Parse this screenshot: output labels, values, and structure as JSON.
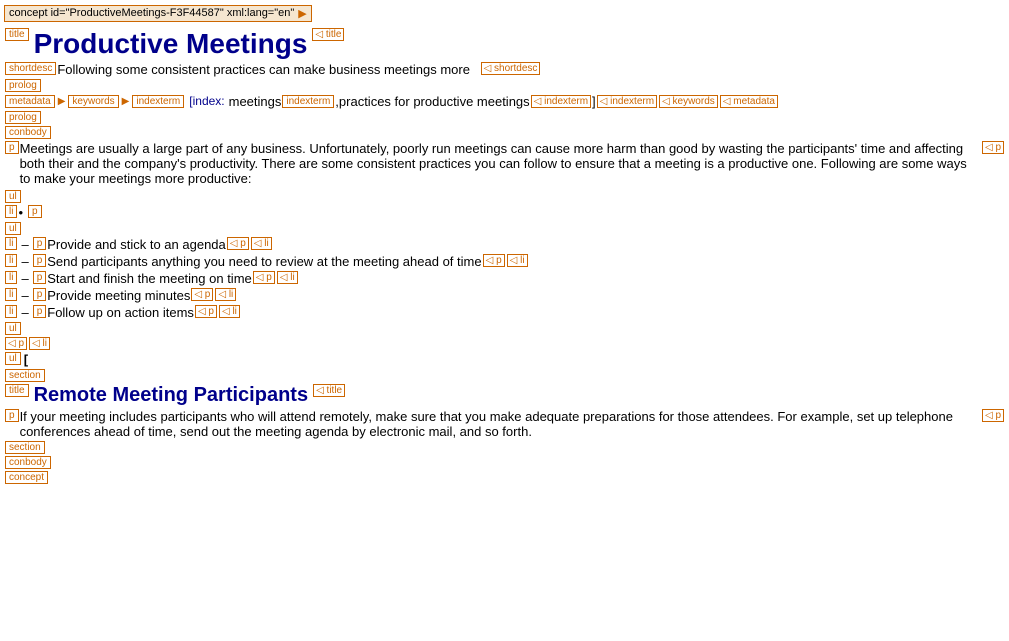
{
  "concept_header": {
    "text": "concept id=\"ProductiveMeetings-F3F44587\" xml:lang=\"en\"",
    "arrow": "▶"
  },
  "title_tag_open": "title",
  "title_tag_close": "title",
  "main_title": "Productive Meetings",
  "shortdesc_tag": "shortdesc",
  "shortdesc_text": "Following some consistent practices can make business meetings more",
  "shortdesc_close": "shortdesc",
  "prolog_tag": "prolog",
  "metadata_tag": "metadata",
  "keywords_tag": "keywords",
  "indexterm_tag": "indexterm",
  "index_label": "index:",
  "index_value1": "meetings",
  "indexterm_close1": "indexterm",
  "index_comma": ",",
  "index_value2": "practices for productive meetings",
  "indexterm_close2": "indexterm",
  "indexterm_close3": "]",
  "indexterm_close4": "indexterm",
  "keywords_close": "keywords",
  "metadata_close": "metadata",
  "prolog_close": "prolog",
  "conbody_tag": "conbody",
  "p_tag": "p",
  "para1": "Meetings are usually a large part of any business. Unfortunately, poorly run meetings can cause more harm than good by wasting the participants' time and affecting both their and the company's productivity. There are some consistent practices you can follow to ensure that a meeting is a productive one. Following are some ways to make your meetings more productive:",
  "p_close": "p",
  "ul_tag": "ul",
  "li_tag": "li",
  "list_items": [
    "Provide and stick to an agenda",
    "Send participants anything you need to review at the meeting ahead of time",
    "Start and finish the meeting on time",
    "Provide meeting minutes",
    "Follow up on action items"
  ],
  "ul_close": "ul",
  "p_tag2": "p",
  "li_close": "li",
  "section_tag": "section",
  "section2_title": "Remote Meeting Participants",
  "section2_para": "If your meeting includes participants who will attend remotely, make sure that you make adequate preparations for those attendees. For example, set up telephone conferences ahead of time, send out the meeting agenda by electronic mail, and so forth.",
  "section_close": "section",
  "conbody_close": "conbody",
  "concept_close": "concept",
  "colors": {
    "tag_border": "#cc6600",
    "tag_text": "#cc6600",
    "title_color": "#00008B",
    "header_bg": "#f5e6d0"
  }
}
